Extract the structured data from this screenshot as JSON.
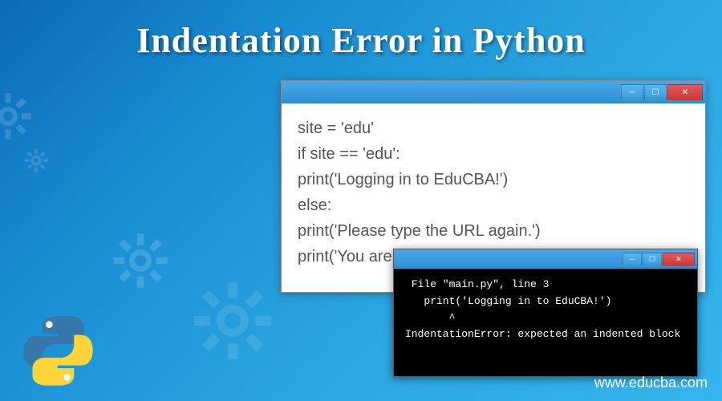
{
  "title": "Indentation Error in Python",
  "code_window": {
    "lines": [
      "site = 'edu'",
      "if site == 'edu':",
      "print('Logging in to EduCBA!')",
      "else:",
      "print('Please type the URL again.')",
      "print('You are ready to go!')"
    ]
  },
  "terminal": {
    "lines": [
      " File \"main.py\", line 3",
      "   print('Logging in to EduCBA!')",
      "       ^",
      "IndentationError: expected an indented block"
    ]
  },
  "website": "www.educba.com"
}
